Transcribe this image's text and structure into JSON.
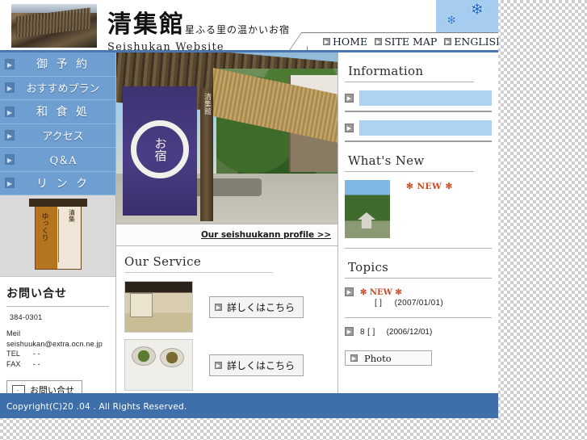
{
  "header": {
    "title_jp": "清集館",
    "tagline_jp": "星ふる里の温かいお宿",
    "title_en": "Seishukan Website",
    "logo_photo": "inn-roof-photo",
    "snow_icon_1": "snowflake-icon",
    "snow_icon_2": "snowflake-icon",
    "nav": [
      {
        "label": "HOME",
        "icon": "chevron-right-icon"
      },
      {
        "label": "SITE MAP",
        "icon": "chevron-right-icon"
      },
      {
        "label": "ENGLISH",
        "icon": "chevron-right-icon"
      }
    ]
  },
  "sidebar": {
    "menu": [
      {
        "label": "御 予 約",
        "icon": "chevron-right-icon"
      },
      {
        "label": "おすすめプラン",
        "icon": "chevron-right-icon"
      },
      {
        "label": "和 食 処",
        "icon": "chevron-right-icon"
      },
      {
        "label": "アクセス",
        "icon": "chevron-right-icon"
      },
      {
        "label": "Q＆A",
        "icon": "chevron-right-icon"
      },
      {
        "label": "リ ン ク",
        "icon": "chevron-right-icon"
      }
    ],
    "lantern_image": "japanese-lantern-photo",
    "lantern_text_left": "ゆっくり",
    "lantern_text_right": "清集",
    "contact": {
      "heading": "お問い合せ",
      "zip": "384-0301",
      "mail_label": "Meil",
      "mail_value": "seishuukan@extra.ocn.ne.jp",
      "tel_label": "TEL",
      "tel_value": "-  -",
      "fax_label": "FAX",
      "fax_value": "-  -",
      "button_label": "お問い合せ",
      "button_icon": "envelope-icon"
    }
  },
  "center": {
    "hero_image": "inn-entrance-noren-photo",
    "hero_noren_text": "お宿",
    "hero_post_text": "清集館",
    "profile_link": "Our seishuukann profile >>",
    "service_title": "Our Service",
    "services": [
      {
        "thumb": "tatami-room-photo",
        "button_label": "詳しくはこちら",
        "icon": "chevron-right-icon"
      },
      {
        "thumb": "japanese-cuisine-photo",
        "button_label": "詳しくはこちら",
        "icon": "chevron-right-icon"
      }
    ]
  },
  "right": {
    "information": {
      "title": "Information",
      "items": [
        {
          "link_text": "",
          "icon": "chevron-right-icon"
        },
        {
          "link_text": "",
          "icon": "chevron-right-icon"
        }
      ]
    },
    "whats_new": {
      "title": "What's New",
      "thumb": "garden-pagoda-photo",
      "badge": "✻ NEW ✻"
    },
    "topics": {
      "title": "Topics",
      "items": [
        {
          "icon": "chevron-right-icon",
          "badge": "✻ NEW ✻",
          "text": "[      ]",
          "date": "(2007/01/01)"
        },
        {
          "icon": "chevron-right-icon",
          "badge": "",
          "text": "8      [      ]",
          "date": "(2006/12/01)"
        }
      ],
      "photo_button": {
        "label": "Photo",
        "icon": "chevron-right-icon"
      }
    }
  },
  "footer": {
    "copyright": "Copyright(C)20 .04        . All Rights Reserved."
  },
  "colors": {
    "brand_blue": "#3f6fab",
    "menu_blue": "#6f9ed1",
    "info_bar_blue": "#aed2f2",
    "accent_orange": "#cc4a22",
    "snow_blue": "#1f6fd0"
  }
}
